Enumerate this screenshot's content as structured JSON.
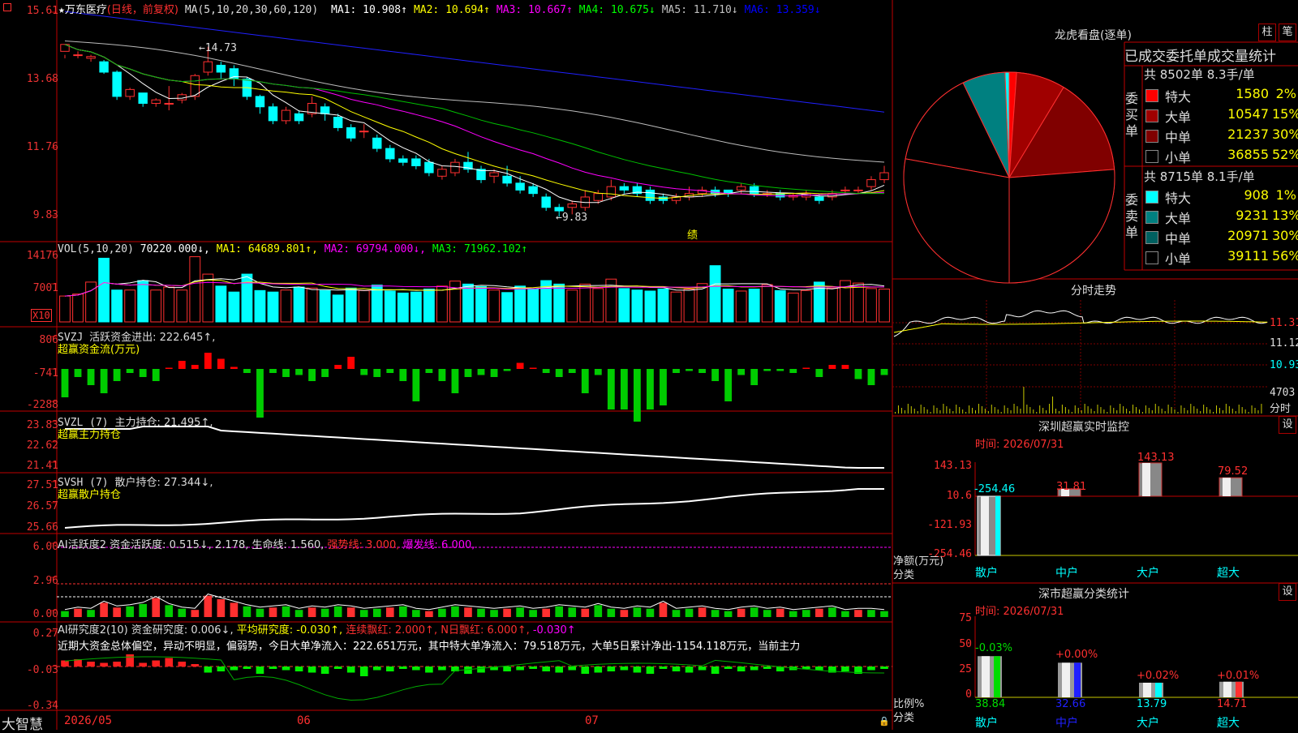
{
  "header": {
    "title": "万东医疗",
    "subtitle": "(日线，前复权)",
    "ma_params": "MA(5,10,20,30,60,120)",
    "ma": [
      {
        "label": "MA1:",
        "value": "10.908↑",
        "color": "#ffffff"
      },
      {
        "label": "MA2:",
        "value": "10.694↑",
        "color": "#ffff00"
      },
      {
        "label": "MA3:",
        "value": "10.667↑",
        "color": "#ff00ff"
      },
      {
        "label": "MA4:",
        "value": "10.675↓",
        "color": "#00ff00"
      },
      {
        "label": "MA5:",
        "value": "11.710↓",
        "color": "#c0c0c0"
      },
      {
        "label": "MA6:",
        "value": "13.359↓",
        "color": "#0000ff"
      }
    ]
  },
  "price_axis": [
    "15.61",
    "13.68",
    "11.76",
    "9.83"
  ],
  "price_marks": {
    "high": "←14.73",
    "low": "←9.83",
    "note": "绩"
  },
  "vol_panel": {
    "title": "VOL(5,10,20)",
    "value": "70220.000↓",
    "ma1": "MA1: 64689.801↑",
    "ma2": "MA2: 69794.000↓",
    "ma3": "MA3: 71962.102↑",
    "axis": [
      "14176",
      "7001"
    ],
    "unit": "X10"
  },
  "svzj_panel": {
    "title": "SVZJ",
    "desc": "活跃资金进出: 222.645↑,",
    "sub": "超赢资金流(万元)",
    "axis": [
      "806",
      "-741",
      "-2288"
    ]
  },
  "svzl_panel": {
    "title": "SVZL (7)",
    "desc": "主力持仓: 21.495↑,",
    "sub": "超赢主力持仓",
    "axis": [
      "23.83",
      "22.62",
      "21.41"
    ]
  },
  "svsh_panel": {
    "title": "SVSH (7)",
    "desc": "散户持仓: 27.344↓,",
    "sub": "超赢散户持仓",
    "axis": [
      "27.51",
      "26.57",
      "25.66"
    ]
  },
  "ai_act_panel": {
    "title": "AI活跃度2",
    "desc": "资金活跃度: 0.515↓, 2.178, 生命线: 1.560,",
    "strong": "强势线: 3.000,",
    "burst": "爆发线: 6.000,",
    "axis": [
      "6.00",
      "2.96",
      "0.00"
    ]
  },
  "ai_res_panel": {
    "title": "AI研究度2(10)",
    "desc": "资金研究度: 0.006↓,",
    "avg": "平均研究度: -0.030↑,",
    "cont": "连续飘红: 2.000↑,",
    "nday": "N日飘红: 6.000↑,",
    "last": "-0.030↑",
    "comment": "近期大资金总体偏空，异动不明显，偏弱势，今日大单净流入：222.651万元，其中特大单净流入：79.518万元，大单5日累计净出-1154.118万元，当前主力",
    "axis": [
      "0.27",
      "-0.03",
      "-0.34"
    ]
  },
  "bottom": {
    "brand": "大智慧",
    "dates": [
      "2026/05",
      "06",
      "07"
    ]
  },
  "dragon": {
    "title": "龙虎看盘(逐单)",
    "btn1": "柱",
    "btn2": "笔",
    "stats_title": "已成交委托单成交量统计",
    "buy_header": "共 8502单 8.3手/单",
    "buy_label": "委买单",
    "buy_rows": [
      {
        "name": "特大",
        "vol": "1580",
        "pct": "2%",
        "color": "#ff0000"
      },
      {
        "name": "大单",
        "vol": "10547",
        "pct": "15%",
        "color": "#a00000"
      },
      {
        "name": "中单",
        "vol": "21237",
        "pct": "30%",
        "color": "#800000"
      },
      {
        "name": "小单",
        "vol": "36855",
        "pct": "52%",
        "color": "#000000"
      }
    ],
    "sell_header": "共 8715单 8.1手/单",
    "sell_label": "委卖单",
    "sell_rows": [
      {
        "name": "特大",
        "vol": "908",
        "pct": "1%",
        "color": "#00ffff"
      },
      {
        "name": "大单",
        "vol": "9231",
        "pct": "13%",
        "color": "#008080"
      },
      {
        "name": "中单",
        "vol": "20971",
        "pct": "30%",
        "color": "#006060"
      },
      {
        "name": "小单",
        "vol": "39111",
        "pct": "56%",
        "color": "#000000"
      }
    ],
    "pie_slices_pct": [
      2,
      15,
      30,
      52,
      1,
      13,
      30,
      56
    ]
  },
  "intraday": {
    "title": "分时走势",
    "axis": [
      "11.31",
      "11.12",
      "10.93",
      "4703"
    ],
    "unit": "分时"
  },
  "sz_monitor": {
    "title": "深圳超赢实时监控",
    "btn": "设",
    "time": "时间: 2026/07/31",
    "axis": [
      "143.13",
      "10.6",
      "-121.93",
      "-254.46"
    ],
    "ylabel": "净额(万元)",
    "xlabel": "分类",
    "cats": [
      "散户",
      "中户",
      "大户",
      "超大"
    ],
    "values": [
      -254.46,
      31.81,
      143.13,
      79.52
    ],
    "value_labels": [
      "-254.46",
      "31.81",
      "143.13",
      "79.52"
    ]
  },
  "sz_class": {
    "title": "深市超赢分类统计",
    "btn": "设",
    "time": "时间: 2026/07/31",
    "axis": [
      "75",
      "50",
      "25",
      "0"
    ],
    "ylabel": "比例%",
    "xlabel": "分类",
    "cats": [
      "散户",
      "中户",
      "大户",
      "超大"
    ],
    "values": [
      38.84,
      32.66,
      13.79,
      14.71
    ],
    "value_labels": [
      "38.84",
      "32.66",
      "13.79",
      "14.71"
    ],
    "change_labels": [
      "-0.03%",
      "+0.00%",
      "+0.02%",
      "+0.01%"
    ]
  },
  "chart_data": {
    "type": "candlestick",
    "title": "万东医疗 (日线，前复权)",
    "candles": [
      [
        14.6,
        14.8,
        14.5,
        14.4
      ],
      [
        14.5,
        14.5,
        14.6,
        14.4
      ],
      [
        14.4,
        14.45,
        14.5,
        14.3
      ],
      [
        14.3,
        14.0,
        14.35,
        13.95
      ],
      [
        14.0,
        13.3,
        14.05,
        13.2
      ],
      [
        13.3,
        13.5,
        13.55,
        13.2
      ],
      [
        13.4,
        13.1,
        13.4,
        13.0
      ],
      [
        13.1,
        13.2,
        13.25,
        13.0
      ],
      [
        13.1,
        13.1,
        13.6,
        12.9
      ],
      [
        13.2,
        13.35,
        13.4,
        13.1
      ],
      [
        13.3,
        13.9,
        13.95,
        13.2
      ],
      [
        14.0,
        14.3,
        14.73,
        13.9
      ],
      [
        14.2,
        14.0,
        14.3,
        13.8
      ],
      [
        14.1,
        13.8,
        14.2,
        13.6
      ],
      [
        13.8,
        13.3,
        13.85,
        13.2
      ],
      [
        13.3,
        13.0,
        13.35,
        12.8
      ],
      [
        13.0,
        12.6,
        13.1,
        12.5
      ],
      [
        12.6,
        12.9,
        13.0,
        12.5
      ],
      [
        12.8,
        12.6,
        12.9,
        12.5
      ],
      [
        12.8,
        13.1,
        13.3,
        12.7
      ],
      [
        13.0,
        12.8,
        13.1,
        12.6
      ],
      [
        12.7,
        12.4,
        12.8,
        12.3
      ],
      [
        12.4,
        12.1,
        12.5,
        12.0
      ],
      [
        12.3,
        12.3,
        12.5,
        12.1
      ],
      [
        12.1,
        11.8,
        12.2,
        11.7
      ],
      [
        11.8,
        11.5,
        11.9,
        11.4
      ],
      [
        11.5,
        11.4,
        11.6,
        11.3
      ],
      [
        11.5,
        11.3,
        11.6,
        11.2
      ],
      [
        11.4,
        11.1,
        11.5,
        11.0
      ],
      [
        11.0,
        11.2,
        11.3,
        10.9
      ],
      [
        11.1,
        11.4,
        11.5,
        11.0
      ],
      [
        11.4,
        11.2,
        11.7,
        11.1
      ],
      [
        11.2,
        10.9,
        11.3,
        10.8
      ],
      [
        11.0,
        11.1,
        11.2,
        10.8
      ],
      [
        11.0,
        10.8,
        11.3,
        10.7
      ],
      [
        10.8,
        10.6,
        11.0,
        10.5
      ],
      [
        10.7,
        10.5,
        10.8,
        10.4
      ],
      [
        10.4,
        10.1,
        10.5,
        10.0
      ],
      [
        10.1,
        10.0,
        10.2,
        9.83
      ],
      [
        10.1,
        10.2,
        10.3,
        9.9
      ],
      [
        10.1,
        10.4,
        10.6,
        10.0
      ],
      [
        10.3,
        10.5,
        10.6,
        10.2
      ],
      [
        10.4,
        10.7,
        10.9,
        10.3
      ],
      [
        10.7,
        10.6,
        10.8,
        10.5
      ],
      [
        10.7,
        10.5,
        10.8,
        10.4
      ],
      [
        10.6,
        10.3,
        10.7,
        10.2
      ],
      [
        10.4,
        10.3,
        10.5,
        10.2
      ],
      [
        10.3,
        10.4,
        10.5,
        10.2
      ],
      [
        10.4,
        10.5,
        10.7,
        10.3
      ],
      [
        10.5,
        10.6,
        10.7,
        10.4
      ],
      [
        10.6,
        10.5,
        10.7,
        10.4
      ],
      [
        10.6,
        10.5,
        10.6,
        10.4
      ],
      [
        10.6,
        10.7,
        10.8,
        10.5
      ],
      [
        10.7,
        10.5,
        10.8,
        10.4
      ],
      [
        10.5,
        10.5,
        10.6,
        10.4
      ],
      [
        10.5,
        10.4,
        10.6,
        10.3
      ],
      [
        10.4,
        10.45,
        10.5,
        10.3
      ],
      [
        10.4,
        10.5,
        10.6,
        10.3
      ],
      [
        10.4,
        10.3,
        10.5,
        10.2
      ],
      [
        10.4,
        10.5,
        10.6,
        10.3
      ],
      [
        10.6,
        10.6,
        10.7,
        10.5
      ],
      [
        10.6,
        10.6,
        10.7,
        10.5
      ],
      [
        10.7,
        10.9,
        11.0,
        10.6
      ],
      [
        10.9,
        11.1,
        11.3,
        10.8
      ]
    ],
    "price_range": [
      9.3,
      15.8
    ]
  }
}
